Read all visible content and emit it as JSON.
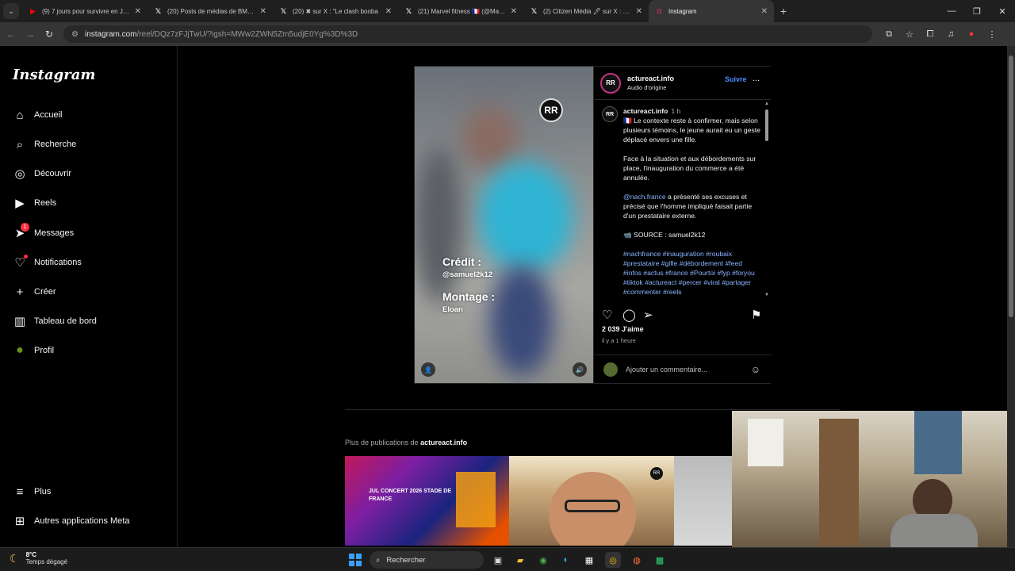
{
  "browser": {
    "tabs": [
      {
        "title": "(9) 7 jours pour survivre en Jungle",
        "icon": "youtube-icon"
      },
      {
        "title": "(20) Posts de médias de BMS | X",
        "icon": "x-icon"
      },
      {
        "title": "(20) ✖ sur X : \"Le clash booba",
        "icon": "x-icon"
      },
      {
        "title": "(21) Marvel fitness 🇫🇷 (@Marvel",
        "icon": "x-icon"
      },
      {
        "title": "(2) Citizen Média 🖋 sur X : \"🇫🇷",
        "icon": "x-icon"
      },
      {
        "title": "Instagram",
        "icon": "instagram-icon",
        "active": true
      }
    ],
    "url_host": "instagram.com",
    "url_path": "/reel/DQz7zFJjTwU/?igsh=MWw2ZWN5Zm5udjE0Yg%3D%3D"
  },
  "sidebar": {
    "logo": "Instagram",
    "items": [
      {
        "label": "Accueil",
        "icon": "home-icon"
      },
      {
        "label": "Recherche",
        "icon": "search-icon"
      },
      {
        "label": "Découvrir",
        "icon": "compass-icon"
      },
      {
        "label": "Reels",
        "icon": "reels-icon"
      },
      {
        "label": "Messages",
        "icon": "messenger-icon",
        "badge": "1"
      },
      {
        "label": "Notifications",
        "icon": "heart-icon"
      },
      {
        "label": "Créer",
        "icon": "plus-icon"
      },
      {
        "label": "Tableau de bord",
        "icon": "dashboard-icon"
      },
      {
        "label": "Profil",
        "icon": "avatar"
      }
    ],
    "bottom": [
      {
        "label": "Plus",
        "icon": "menu-icon"
      },
      {
        "label": "Autres applications Meta",
        "icon": "meta-apps-icon"
      }
    ]
  },
  "video": {
    "credit_label": "Crédit :",
    "credit_value": "@samuel2k12",
    "montage_label": "Montage :",
    "montage_value": "Eloan",
    "watermark": "RR"
  },
  "post": {
    "username": "actureact.info",
    "audio": "Audio d'origine",
    "follow": "Suivre",
    "more": "...",
    "avatar_text": "RR",
    "caption_time": "1 h",
    "caption_p1": "🇫🇷 Le contexte reste à confirmer, mais selon plusieurs témoins, le jeune aurait eu un geste déplacé envers une fille.",
    "caption_p2": "Face à la situation et aux débordements sur place, l'inauguration du commerce a été annulée.",
    "caption_mention": "@nach.france",
    "caption_p3": " a présenté ses excuses et précisé que l'homme impliqué faisait partie d'un prestataire externe.",
    "caption_source": "📹 SOURCE : samuel2k12",
    "hashtags": "#nachfrance #inauguration #roubaix #prestataire #gifle #débordement #feed #infos #actus #france #Pourtoi #fyp #foryou #tiktok #actureact #percer #viral #partager #commenter #reels",
    "likes": "2 039 J'aime",
    "ago": "il y a 1 heure",
    "comment_placeholder": "Ajouter un commentaire..."
  },
  "more_posts": {
    "prefix": "Plus de publications de ",
    "user": "actureact.info",
    "thumb1_text": "JUL CONCERT 2026 STADE DE FRANCE"
  },
  "taskbar": {
    "temp": "8°C",
    "weather": "Temps dégagé",
    "search": "Rechercher"
  },
  "colors": {
    "accent_blue": "#4c8dff",
    "notification_red": "#ff3040"
  }
}
